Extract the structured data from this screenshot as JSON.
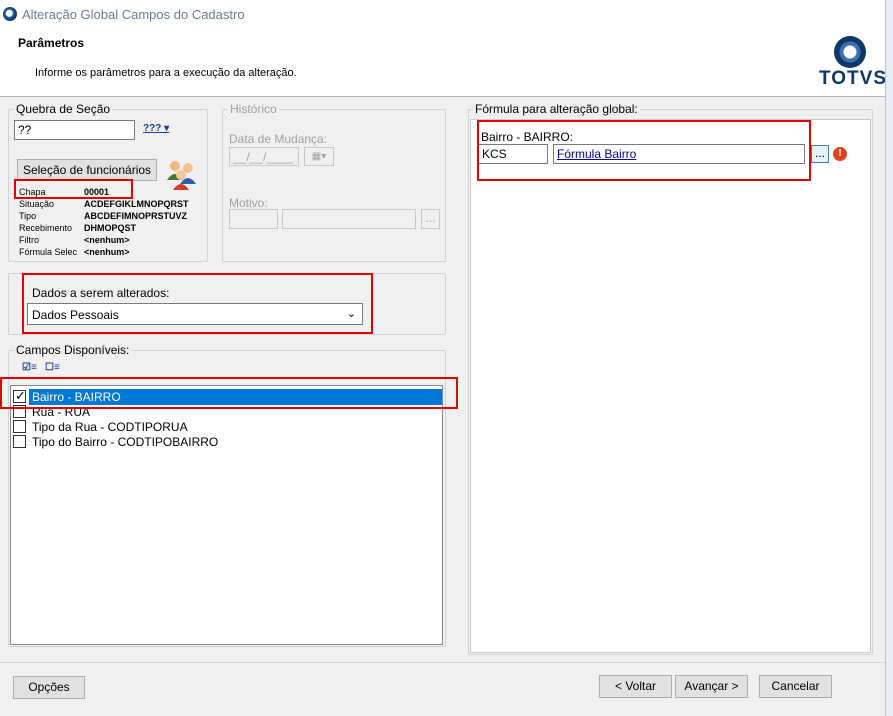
{
  "window": {
    "title": "Alteração Global Campos do Cadastro"
  },
  "header": {
    "title": "Parâmetros",
    "subtitle": "Informe os parâmetros para a execução da alteração.",
    "brand": "TOTVS"
  },
  "quebra": {
    "label": "Quebra de Seção",
    "value": "??",
    "button_label": "???"
  },
  "historico": {
    "label": "Histórico",
    "data_label": "Data de Mudança:",
    "data_value": "__/__/____",
    "motivo_label": "Motivo:",
    "browse": "..."
  },
  "selecao": {
    "button": "Seleção de funcionários",
    "rows": [
      {
        "label": "Chapa",
        "value": "00001"
      },
      {
        "label": "Situação",
        "value": "ACDEFGIKLMNOPQRST"
      },
      {
        "label": "Tipo",
        "value": "ABCDEFIMNOPRSTUVZ"
      },
      {
        "label": "Recebimento",
        "value": "DHMOPQST"
      },
      {
        "label": "Filtro",
        "value": "<nenhum>"
      },
      {
        "label": "Fórmula Selec",
        "value": "<nenhum>"
      }
    ]
  },
  "dados": {
    "label": "Dados a serem alterados:",
    "selected": "Dados Pessoais"
  },
  "campos": {
    "label": "Campos Disponíveis:",
    "items": [
      {
        "label": "Bairro - BAIRRO",
        "checked": true,
        "selected": true
      },
      {
        "label": "Rua - RUA",
        "checked": false,
        "selected": false
      },
      {
        "label": "Tipo da Rua - CODTIPORUA",
        "checked": false,
        "selected": false
      },
      {
        "label": "Tipo do Bairro - CODTIPOBAIRRO",
        "checked": false,
        "selected": false
      }
    ]
  },
  "formula": {
    "label": "Fórmula para alteração global:",
    "field_label": "Bairro - BAIRRO:",
    "code": "KCS",
    "link": "Fórmula Bairro",
    "browse": "...",
    "warn": "!"
  },
  "footer": {
    "options": "Opções",
    "back": "< Voltar",
    "next": "Avançar >",
    "cancel": "Cancelar"
  },
  "colors": {
    "red_highlight": "#e00000",
    "selection": "#0078d7",
    "brand": "#0e3866"
  }
}
